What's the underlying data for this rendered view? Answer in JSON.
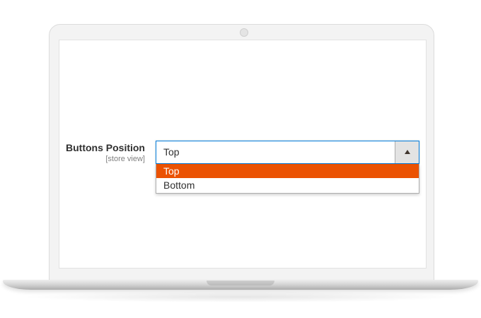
{
  "field": {
    "label": "Buttons Position",
    "scope": "[store view]"
  },
  "select": {
    "value": "Top",
    "options": [
      {
        "label": "Top",
        "selected": true
      },
      {
        "label": "Bottom",
        "selected": false
      }
    ]
  },
  "colors": {
    "highlight": "#eb5202",
    "focus_border": "#007bdb",
    "label_text": "#303030",
    "scope_text": "#808080"
  },
  "icons": {
    "dropdown_toggle": "caret-up-icon",
    "camera": "webcam-dot"
  }
}
